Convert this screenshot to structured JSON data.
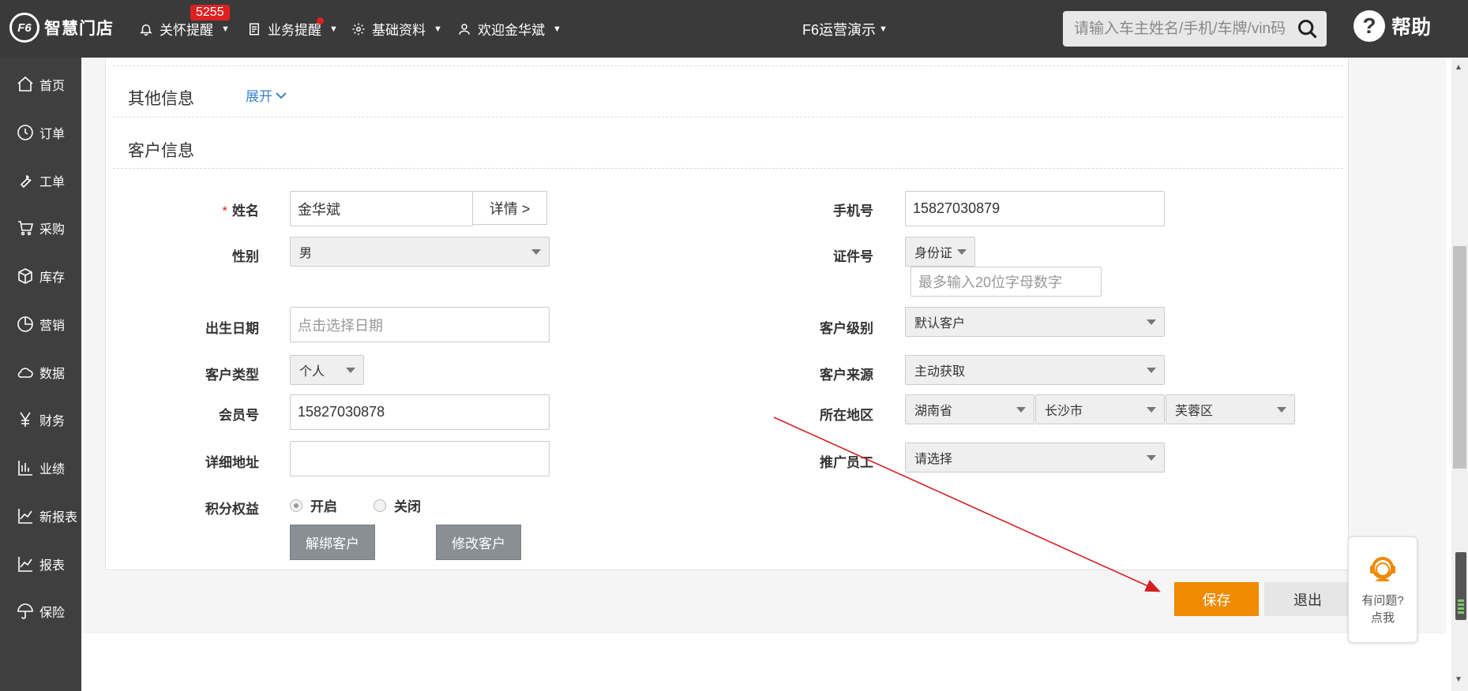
{
  "header": {
    "logo_mark": "F6",
    "logo_text": "智慧门店",
    "nav": [
      {
        "label": "关怀提醒",
        "badge": "5255"
      },
      {
        "label": "业务提醒"
      },
      {
        "label": "基础资料"
      },
      {
        "label": "欢迎金华斌"
      }
    ],
    "store": "F6运营演示",
    "search_placeholder": "请输入车主姓名/手机/车牌/vin码",
    "help_label": "帮助"
  },
  "sidebar": {
    "items": [
      {
        "label": "首页",
        "icon": "home-icon"
      },
      {
        "label": "订单",
        "icon": "clock-icon"
      },
      {
        "label": "工单",
        "icon": "wrench-icon"
      },
      {
        "label": "采购",
        "icon": "cart-icon"
      },
      {
        "label": "库存",
        "icon": "box-icon"
      },
      {
        "label": "营销",
        "icon": "pie-icon"
      },
      {
        "label": "数据",
        "icon": "cloud-icon"
      },
      {
        "label": "财务",
        "icon": "yen-icon"
      },
      {
        "label": "业绩",
        "icon": "bar-chart-icon"
      },
      {
        "label": "新报表",
        "icon": "line-chart-icon"
      },
      {
        "label": "报表",
        "icon": "line-chart-icon"
      },
      {
        "label": "保险",
        "icon": "umbrella-icon"
      }
    ]
  },
  "sections": {
    "other_info": "其他信息",
    "expand_label": "展开",
    "customer_info": "客户信息"
  },
  "form": {
    "name_label": "姓名",
    "name_value": "金华斌",
    "detail_button": "详情 >",
    "phone_label": "手机号",
    "phone_value": "15827030879",
    "gender_label": "性别",
    "gender_value": "男",
    "id_label": "证件号",
    "id_type": "身份证",
    "id_placeholder": "最多输入20位字母数字",
    "birth_label": "出生日期",
    "birth_placeholder": "点击选择日期",
    "level_label": "客户级别",
    "level_value": "默认客户",
    "type_label": "客户类型",
    "type_value": "个人",
    "source_label": "客户来源",
    "source_value": "主动获取",
    "member_label": "会员号",
    "member_value": "15827030878",
    "region_label": "所在地区",
    "province": "湖南省",
    "city": "长沙市",
    "district": "芙蓉区",
    "address_label": "详细地址",
    "address_value": "",
    "promoter_label": "推广员工",
    "promoter_value": "请选择",
    "points_label": "积分权益",
    "points_on": "开启",
    "points_off": "关闭",
    "points_selected": "开启",
    "unbind_button": "解绑客户",
    "modify_button": "修改客户"
  },
  "actions": {
    "save": "保存",
    "exit": "退出"
  },
  "support": {
    "line1": "有问题?",
    "line2": "点我"
  },
  "colors": {
    "topbar": "#3a3a3a",
    "sidebar": "#3f3f3f",
    "accent_orange": "#f08a00",
    "badge_red": "#e02020",
    "link_blue": "#3a83c8",
    "annotation_arrow": "#d42020"
  }
}
